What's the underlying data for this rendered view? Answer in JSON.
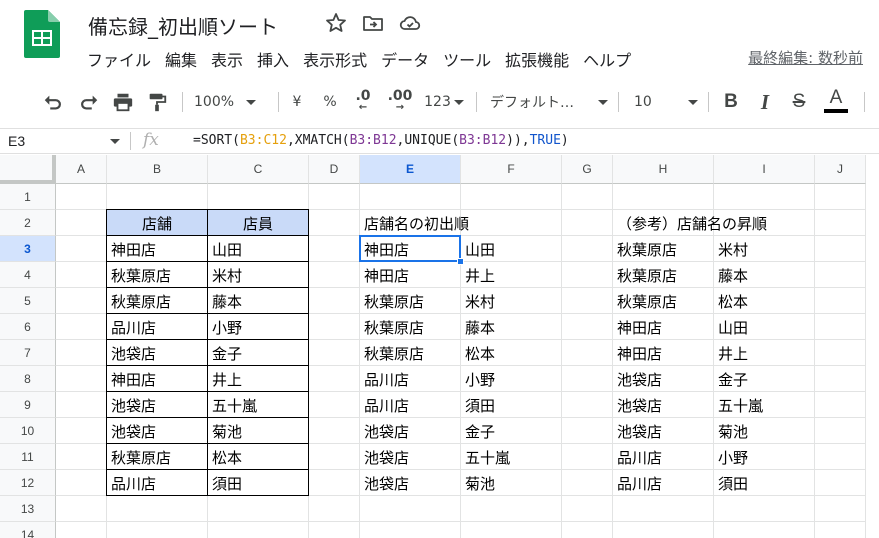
{
  "app": {
    "title": "備忘録_初出順ソート",
    "last_edit": "最終編集: 数秒前",
    "colors": {
      "brand_green": "#0f9d58",
      "selection_blue": "#1a73e8",
      "header_fill": "#c9daf8"
    }
  },
  "menu": [
    "ファイル",
    "編集",
    "表示",
    "挿入",
    "表示形式",
    "データ",
    "ツール",
    "拡張機能",
    "ヘルプ"
  ],
  "toolbar": {
    "zoom": "100%",
    "currency": "¥",
    "percent": "%",
    "dec_decrease": ".0",
    "dec_increase": ".00",
    "more_formats": "123",
    "font": "デフォルト…",
    "font_size": "10",
    "bold": "B",
    "italic": "I",
    "strike": "S",
    "text_color": "A",
    "icons": [
      "undo-icon",
      "redo-icon",
      "print-icon",
      "paint-format-icon",
      "bold-icon",
      "italic-icon",
      "strikethrough-icon",
      "text-color-icon"
    ]
  },
  "formula_bar": {
    "cell_ref": "E3",
    "fx": "fx",
    "parts": [
      {
        "text": "=SORT(",
        "kind": "plain"
      },
      {
        "text": "B3:C12",
        "kind": "rng1"
      },
      {
        "text": ",XMATCH(",
        "kind": "plain"
      },
      {
        "text": "B3:B12",
        "kind": "rng2"
      },
      {
        "text": ",UNIQUE(",
        "kind": "plain"
      },
      {
        "text": "B3:B12",
        "kind": "rng3"
      },
      {
        "text": ")),",
        "kind": "plain"
      },
      {
        "text": "TRUE",
        "kind": "bool"
      },
      {
        "text": ")",
        "kind": "plain"
      }
    ]
  },
  "grid": {
    "columns": [
      "A",
      "B",
      "C",
      "D",
      "E",
      "F",
      "G",
      "H",
      "I",
      "J"
    ],
    "rows": [
      "1",
      "2",
      "3",
      "4",
      "5",
      "6",
      "7",
      "8",
      "9",
      "10",
      "11",
      "12",
      "13",
      "14"
    ],
    "selected_cell": "E3",
    "cells": {
      "B2": "店舗",
      "C2": "店員",
      "E2": "店舗名の初出順",
      "H2": "（参考）店舗名の昇順",
      "B3": "神田店",
      "C3": "山田",
      "E3": "神田店",
      "F3": "山田",
      "H3": "秋葉原店",
      "I3": "米村",
      "B4": "秋葉原店",
      "C4": "米村",
      "E4": "神田店",
      "F4": "井上",
      "H4": "秋葉原店",
      "I4": "藤本",
      "B5": "秋葉原店",
      "C5": "藤本",
      "E5": "秋葉原店",
      "F5": "米村",
      "H5": "秋葉原店",
      "I5": "松本",
      "B6": "品川店",
      "C6": "小野",
      "E6": "秋葉原店",
      "F6": "藤本",
      "H6": "神田店",
      "I6": "山田",
      "B7": "池袋店",
      "C7": "金子",
      "E7": "秋葉原店",
      "F7": "松本",
      "H7": "神田店",
      "I7": "井上",
      "B8": "神田店",
      "C8": "井上",
      "E8": "品川店",
      "F8": "小野",
      "H8": "池袋店",
      "I8": "金子",
      "B9": "池袋店",
      "C9": "五十嵐",
      "E9": "品川店",
      "F9": "須田",
      "H9": "池袋店",
      "I9": "五十嵐",
      "B10": "池袋店",
      "C10": "菊池",
      "E10": "池袋店",
      "F10": "金子",
      "H10": "池袋店",
      "I10": "菊池",
      "B11": "秋葉原店",
      "C11": "松本",
      "E11": "池袋店",
      "F11": "五十嵐",
      "H11": "品川店",
      "I11": "小野",
      "B12": "品川店",
      "C12": "須田",
      "E12": "池袋店",
      "F12": "菊池",
      "H12": "品川店",
      "I12": "須田"
    }
  }
}
